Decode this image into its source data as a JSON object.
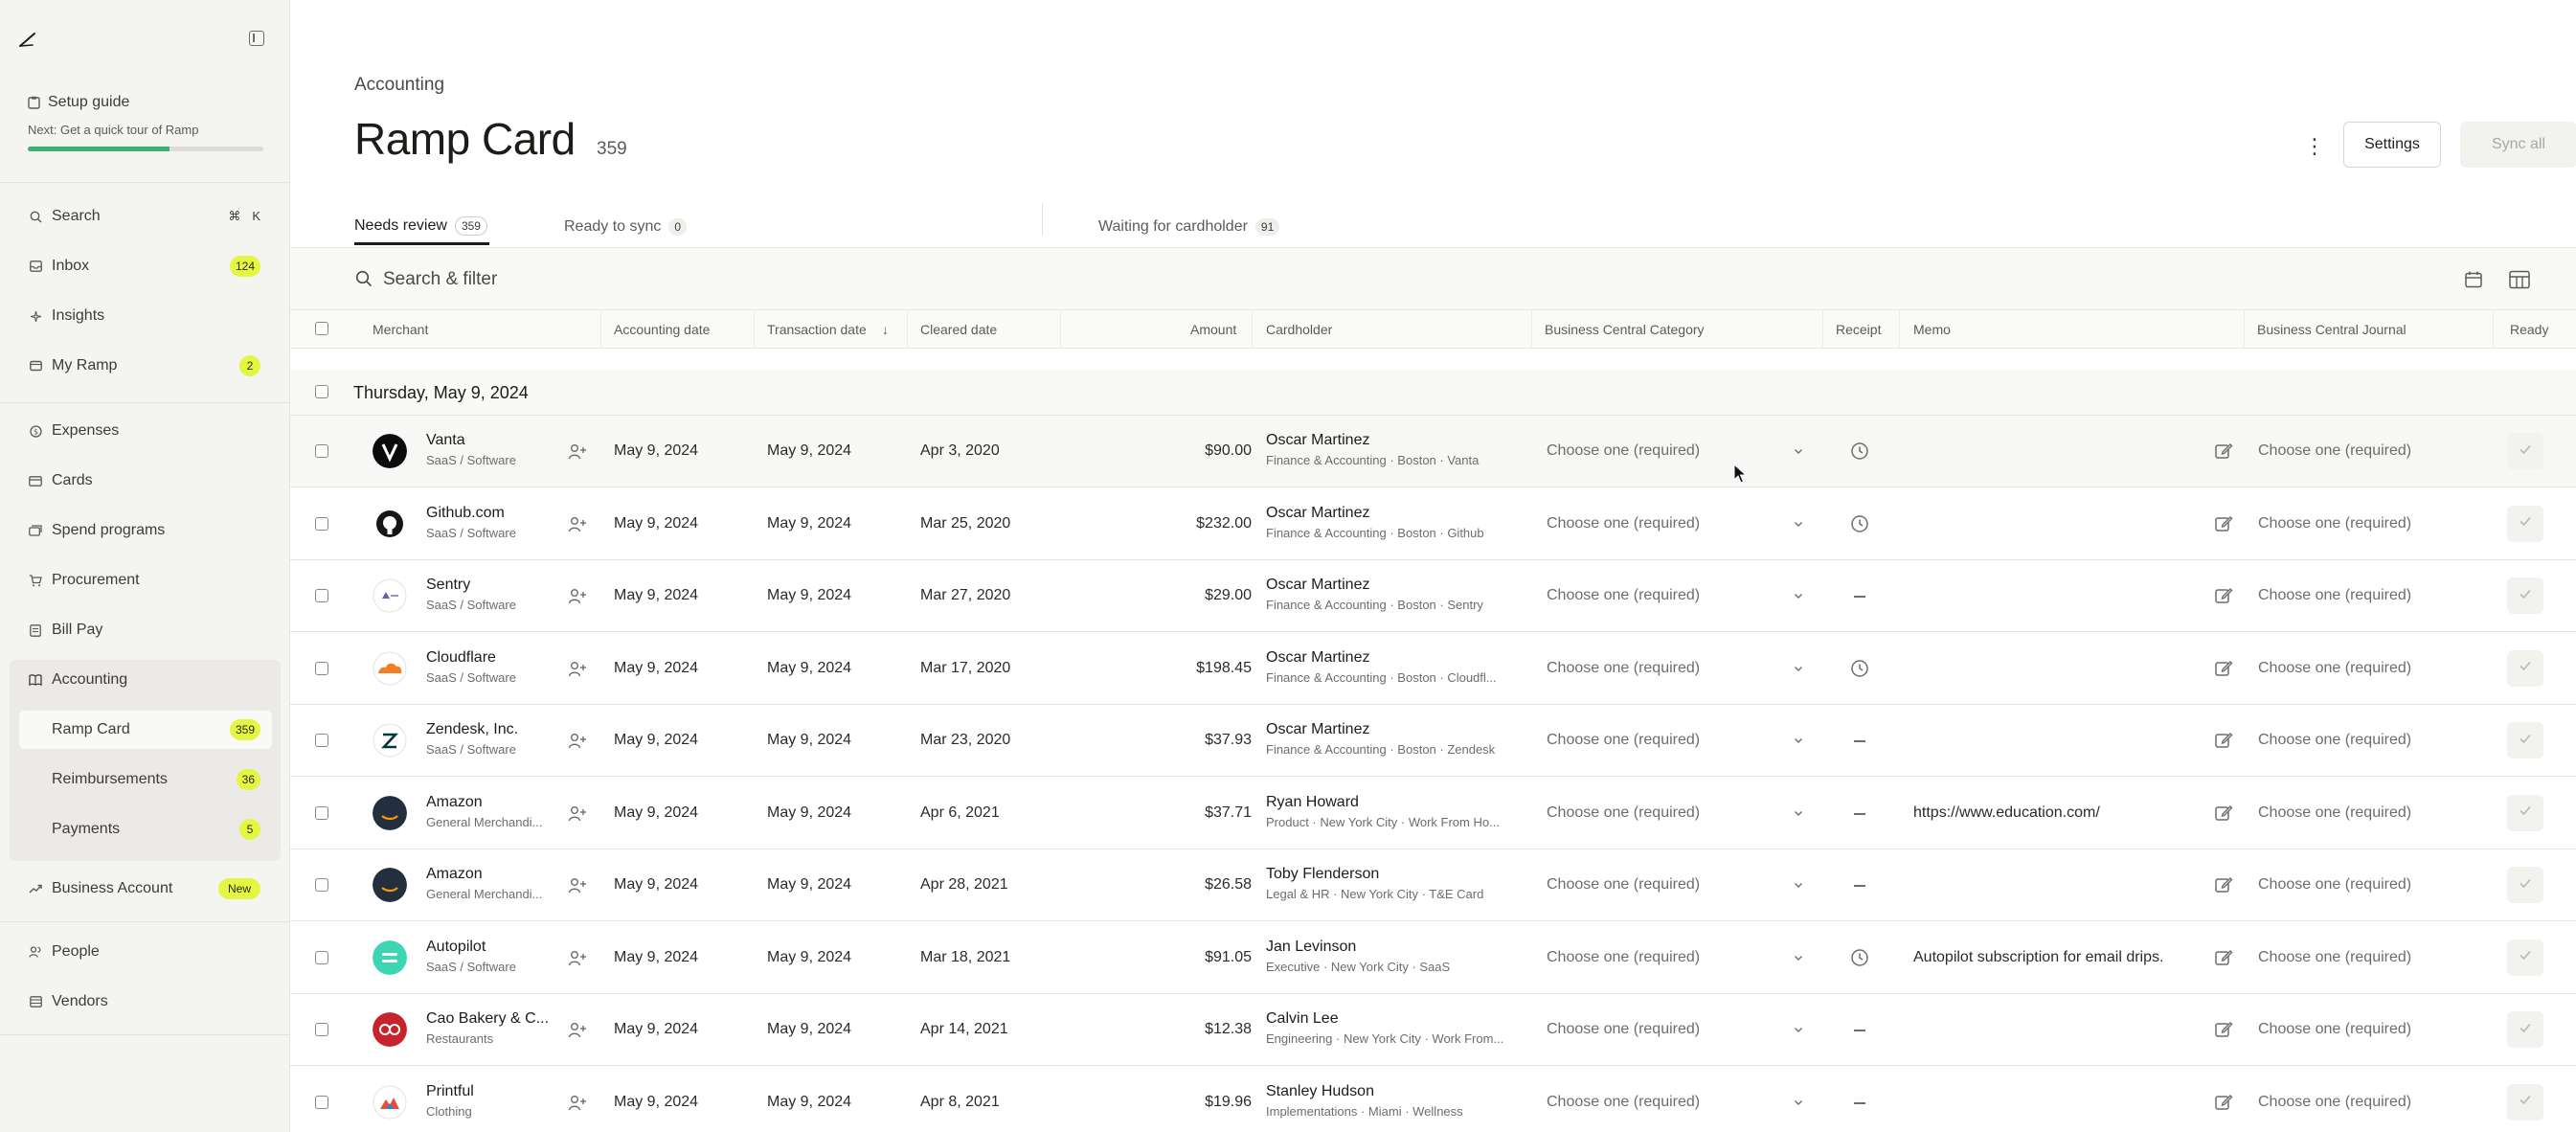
{
  "sidebar": {
    "setup_title": "Setup guide",
    "setup_next": "Next: Get a quick tour of Ramp",
    "setup_progress": 0.6,
    "search": {
      "label": "Search",
      "shortcut_mod": "⌘",
      "shortcut_key": "K"
    },
    "inbox": {
      "label": "Inbox",
      "badge": "124"
    },
    "insights": {
      "label": "Insights"
    },
    "my_ramp": {
      "label": "My Ramp",
      "badge": "2"
    },
    "expenses": {
      "label": "Expenses"
    },
    "cards": {
      "label": "Cards"
    },
    "spend_programs": {
      "label": "Spend programs"
    },
    "procurement": {
      "label": "Procurement"
    },
    "bill_pay": {
      "label": "Bill Pay"
    },
    "accounting": {
      "label": "Accounting"
    },
    "ramp_card": {
      "label": "Ramp Card",
      "badge": "359"
    },
    "reimbursements": {
      "label": "Reimbursements",
      "badge": "36"
    },
    "payments": {
      "label": "Payments",
      "badge": "5"
    },
    "business_account": {
      "label": "Business Account",
      "badge": "New"
    },
    "people": {
      "label": "People"
    },
    "vendors": {
      "label": "Vendors"
    }
  },
  "header": {
    "breadcrumb": "Accounting",
    "title": "Ramp Card",
    "count": "359",
    "settings_label": "Settings",
    "sync_label": "Sync all"
  },
  "tabs": [
    {
      "label": "Needs review",
      "count": "359"
    },
    {
      "label": "Ready to sync",
      "count": "0"
    },
    {
      "label": "Waiting for cardholder",
      "count": "91"
    }
  ],
  "search": {
    "placeholder": "Search & filter"
  },
  "columns": {
    "merchant": "Merchant",
    "accounting_date": "Accounting date",
    "transaction_date": "Transaction date",
    "cleared_date": "Cleared date",
    "amount": "Amount",
    "cardholder": "Cardholder",
    "category": "Business Central Category",
    "receipt": "Receipt",
    "memo": "Memo",
    "journal": "Business Central Journal",
    "ready": "Ready"
  },
  "group": {
    "label": "Thursday, May 9, 2024"
  },
  "rows": [
    {
      "merchant": "Vanta",
      "category": "SaaS / Software",
      "accounting_date": "May 9, 2024",
      "transaction_date": "May 9, 2024",
      "cleared_date": "Apr 3, 2020",
      "amount": "$90.00",
      "cardholder": "Oscar Martinez",
      "cardholder_sub": "Finance & Accounting · Boston · Vanta",
      "bc_category": "Choose one (required)",
      "receipt": "clock",
      "memo": "",
      "bc_journal": "Choose one (required)"
    },
    {
      "merchant": "Github.com",
      "category": "SaaS / Software",
      "accounting_date": "May 9, 2024",
      "transaction_date": "May 9, 2024",
      "cleared_date": "Mar 25, 2020",
      "amount": "$232.00",
      "cardholder": "Oscar Martinez",
      "cardholder_sub": "Finance & Accounting · Boston · Github",
      "bc_category": "Choose one (required)",
      "receipt": "clock",
      "memo": "",
      "bc_journal": "Choose one (required)"
    },
    {
      "merchant": "Sentry",
      "category": "SaaS / Software",
      "accounting_date": "May 9, 2024",
      "transaction_date": "May 9, 2024",
      "cleared_date": "Mar 27, 2020",
      "amount": "$29.00",
      "cardholder": "Oscar Martinez",
      "cardholder_sub": "Finance & Accounting · Boston · Sentry",
      "bc_category": "Choose one (required)",
      "receipt": "dash",
      "memo": "",
      "bc_journal": "Choose one (required)"
    },
    {
      "merchant": "Cloudflare",
      "category": "SaaS / Software",
      "accounting_date": "May 9, 2024",
      "transaction_date": "May 9, 2024",
      "cleared_date": "Mar 17, 2020",
      "amount": "$198.45",
      "cardholder": "Oscar Martinez",
      "cardholder_sub": "Finance & Accounting · Boston · Cloudfl...",
      "bc_category": "Choose one (required)",
      "receipt": "clock",
      "memo": "",
      "bc_journal": "Choose one (required)"
    },
    {
      "merchant": "Zendesk, Inc.",
      "category": "SaaS / Software",
      "accounting_date": "May 9, 2024",
      "transaction_date": "May 9, 2024",
      "cleared_date": "Mar 23, 2020",
      "amount": "$37.93",
      "cardholder": "Oscar Martinez",
      "cardholder_sub": "Finance & Accounting · Boston · Zendesk",
      "bc_category": "Choose one (required)",
      "receipt": "dash",
      "memo": "",
      "bc_journal": "Choose one (required)"
    },
    {
      "merchant": "Amazon",
      "category": "General Merchandi...",
      "accounting_date": "May 9, 2024",
      "transaction_date": "May 9, 2024",
      "cleared_date": "Apr 6, 2021",
      "amount": "$37.71",
      "cardholder": "Ryan Howard",
      "cardholder_sub": "Product · New York City · Work From Ho...",
      "bc_category": "Choose one (required)",
      "receipt": "dash",
      "memo": "https://www.education.com/",
      "bc_journal": "Choose one (required)"
    },
    {
      "merchant": "Amazon",
      "category": "General Merchandi...",
      "accounting_date": "May 9, 2024",
      "transaction_date": "May 9, 2024",
      "cleared_date": "Apr 28, 2021",
      "amount": "$26.58",
      "cardholder": "Toby Flenderson",
      "cardholder_sub": "Legal & HR · New York City · T&E Card",
      "bc_category": "Choose one (required)",
      "receipt": "dash",
      "memo": "",
      "bc_journal": "Choose one (required)"
    },
    {
      "merchant": "Autopilot",
      "category": "SaaS / Software",
      "accounting_date": "May 9, 2024",
      "transaction_date": "May 9, 2024",
      "cleared_date": "Mar 18, 2021",
      "amount": "$91.05",
      "cardholder": "Jan Levinson",
      "cardholder_sub": "Executive · New York City · SaaS",
      "bc_category": "Choose one (required)",
      "receipt": "clock",
      "memo": "Autopilot subscription for email drips.",
      "bc_journal": "Choose one (required)"
    },
    {
      "merchant": "Cao Bakery & C...",
      "category": "Restaurants",
      "accounting_date": "May 9, 2024",
      "transaction_date": "May 9, 2024",
      "cleared_date": "Apr 14, 2021",
      "amount": "$12.38",
      "cardholder": "Calvin Lee",
      "cardholder_sub": "Engineering · New York City · Work From...",
      "bc_category": "Choose one (required)",
      "receipt": "dash",
      "memo": "",
      "bc_journal": "Choose one (required)"
    },
    {
      "merchant": "Printful",
      "category": "Clothing",
      "accounting_date": "May 9, 2024",
      "transaction_date": "May 9, 2024",
      "cleared_date": "Apr 8, 2021",
      "amount": "$19.96",
      "cardholder": "Stanley Hudson",
      "cardholder_sub": "Implementations · Miami · Wellness",
      "bc_category": "Choose one (required)",
      "receipt": "dash",
      "memo": "",
      "bc_journal": "Choose one (required)"
    }
  ],
  "colors": {
    "accent_badge": "#e4f542",
    "progress": "#3bb273"
  }
}
